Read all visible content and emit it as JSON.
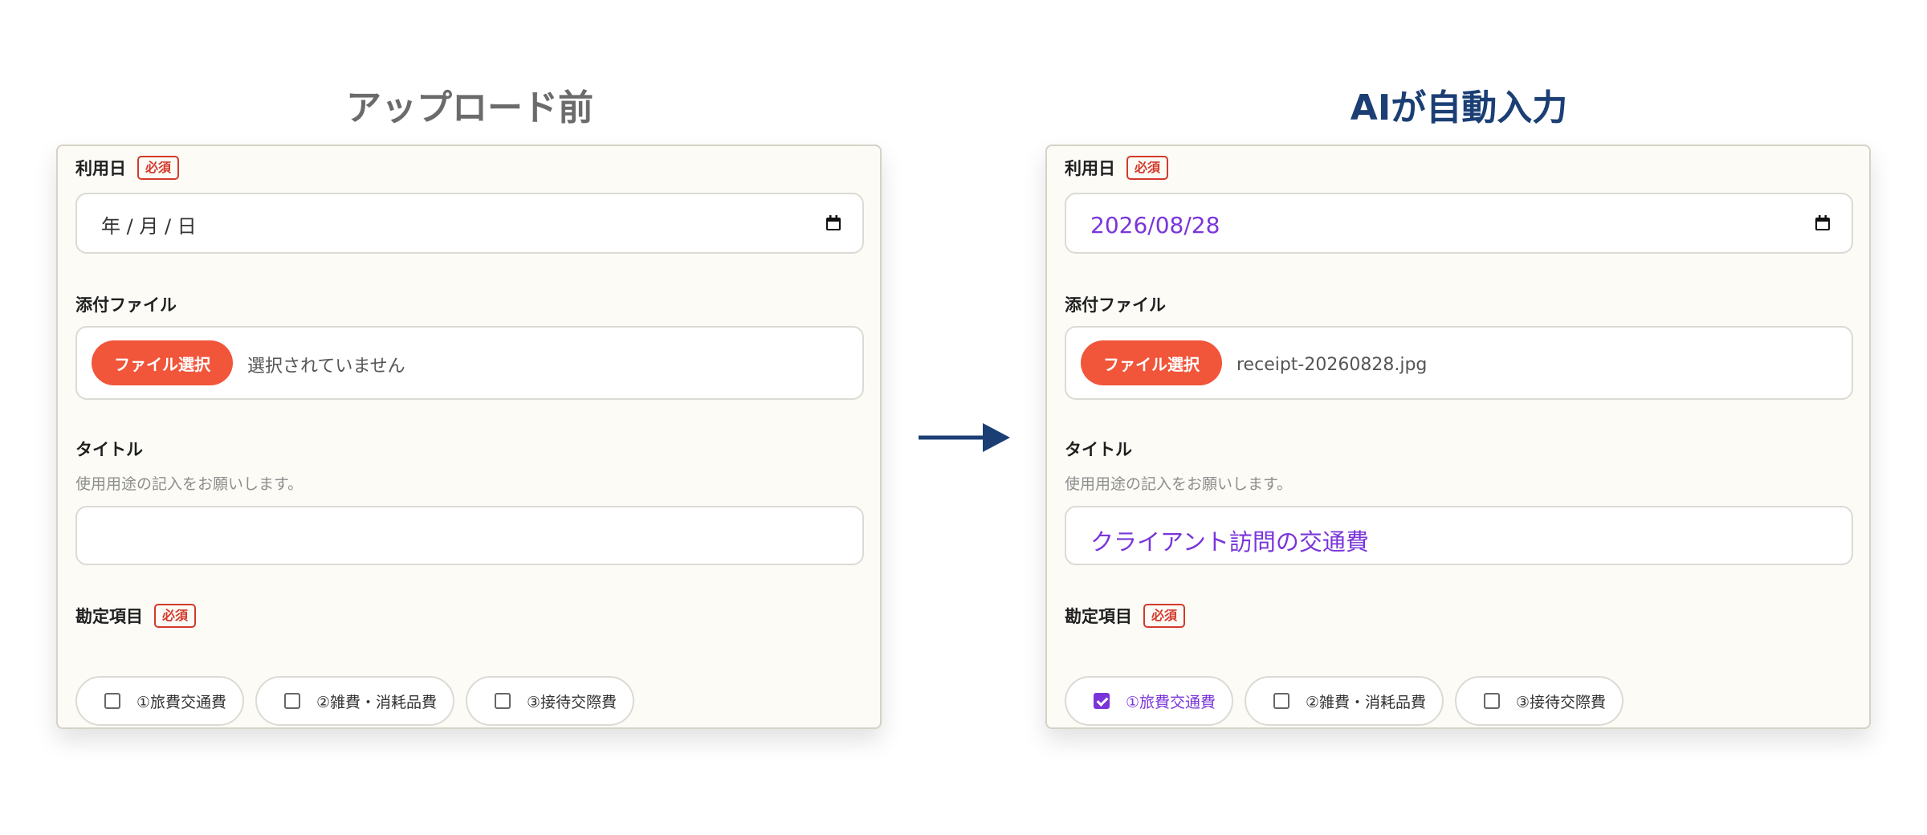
{
  "before": {
    "heading": "アップロード前",
    "date": {
      "label": "利用日",
      "required": "必須",
      "value": "年 / 月 / 日"
    },
    "file": {
      "label": "添付ファイル",
      "button": "ファイル選択",
      "status": "選択されていません"
    },
    "title": {
      "label": "タイトル",
      "hint": "使用用途の記入をお願いします。",
      "value": ""
    },
    "account": {
      "label": "勘定項目",
      "required": "必須",
      "options": [
        {
          "label": "①旅費交通費",
          "checked": false
        },
        {
          "label": "②雑費・消耗品費",
          "checked": false
        },
        {
          "label": "③接待交際費",
          "checked": false
        }
      ]
    }
  },
  "after": {
    "heading": "AIが自動入力",
    "date": {
      "label": "利用日",
      "required": "必須",
      "value": "2026/08/28"
    },
    "file": {
      "label": "添付ファイル",
      "button": "ファイル選択",
      "status": "receipt-20260828.jpg"
    },
    "title": {
      "label": "タイトル",
      "hint": "使用用途の記入をお願いします。",
      "value": "クライアント訪問の交通費"
    },
    "account": {
      "label": "勘定項目",
      "required": "必須",
      "options": [
        {
          "label": "①旅費交通費",
          "checked": true
        },
        {
          "label": "②雑費・消耗品費",
          "checked": false
        },
        {
          "label": "③接待交際費",
          "checked": false
        }
      ]
    }
  },
  "colors": {
    "arrow": "#1b3f75",
    "accent": "#f1553a",
    "filled": "#7a35d9",
    "required": "#d33a2c"
  },
  "icons": {
    "date": "calendar-icon",
    "transition": "right-arrow-icon",
    "checkbox": "checkbox-icon"
  }
}
